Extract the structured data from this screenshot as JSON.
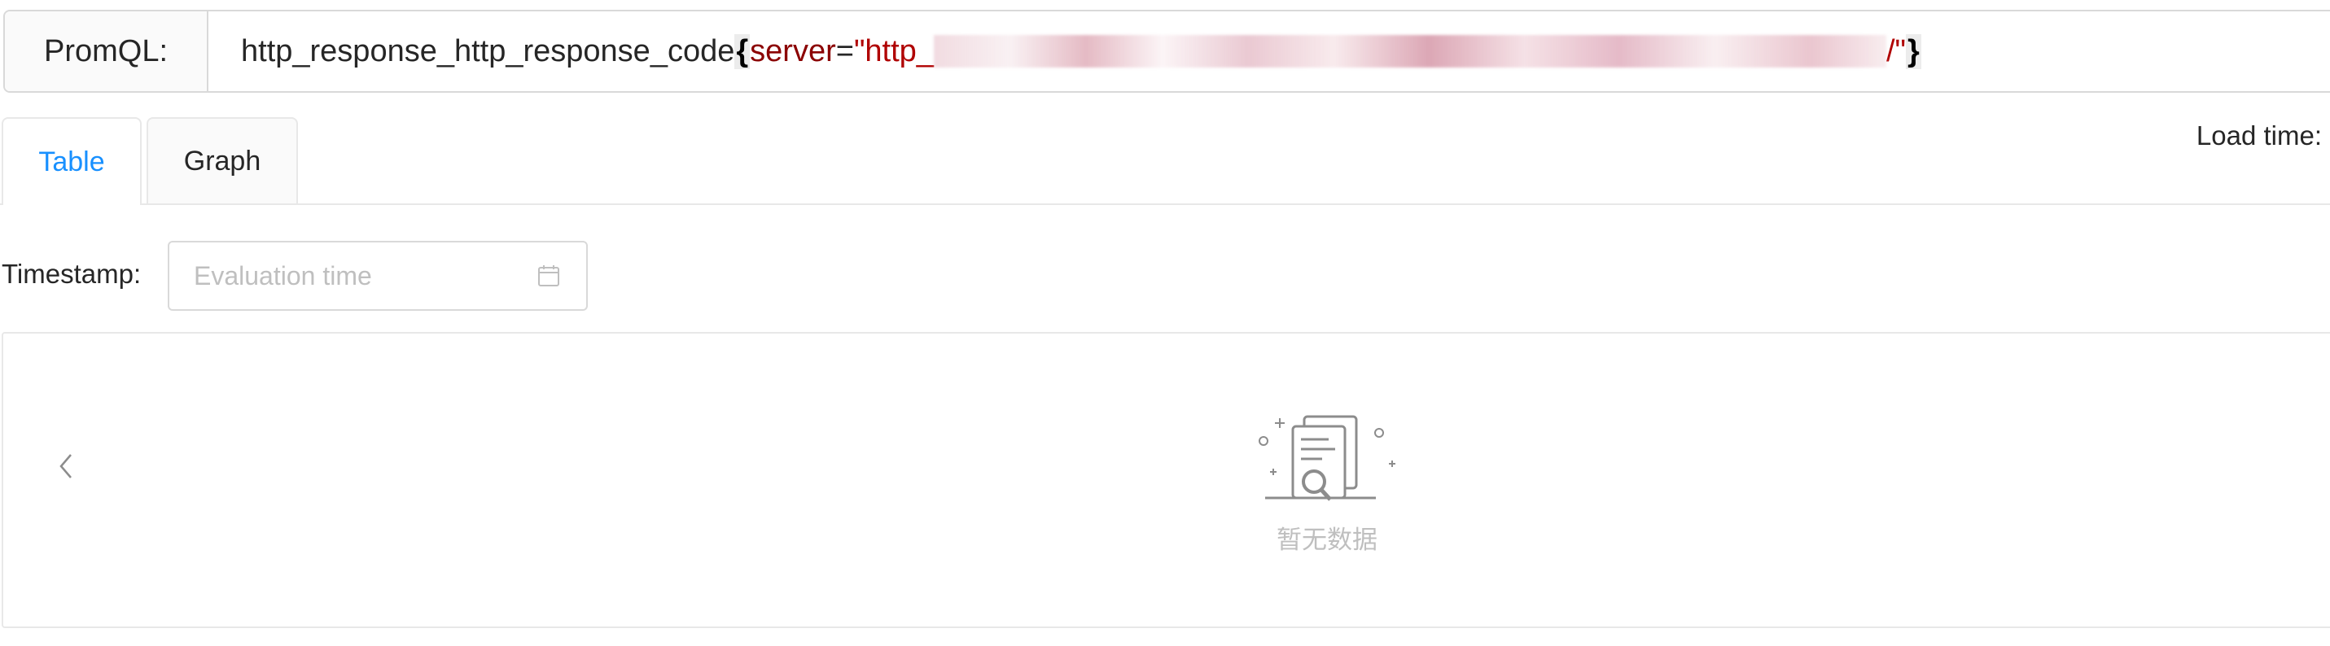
{
  "query": {
    "label": "PromQL:",
    "metric": "http_response_http_response_code",
    "brace_open": "{",
    "label_name": "server",
    "operator": "=",
    "value_start": "\"http_",
    "value_end": "/\"",
    "brace_close": "}"
  },
  "tabs": [
    {
      "label": "Table",
      "active": true
    },
    {
      "label": "Graph",
      "active": false
    }
  ],
  "load_time_label": "Load time:",
  "timestamp": {
    "label": "Timestamp:",
    "placeholder": "Evaluation time",
    "value": ""
  },
  "results": {
    "empty_text": "暂无数据"
  },
  "colors": {
    "accent": "#1890ff",
    "label_name": "#8b0000",
    "string_value": "#b00000",
    "border": "#d9d9d9",
    "placeholder": "#bfbfbf"
  },
  "icons": {
    "timestamp": "calendar-icon",
    "pagination": "chevron-left-icon",
    "empty": "empty-data-icon"
  }
}
